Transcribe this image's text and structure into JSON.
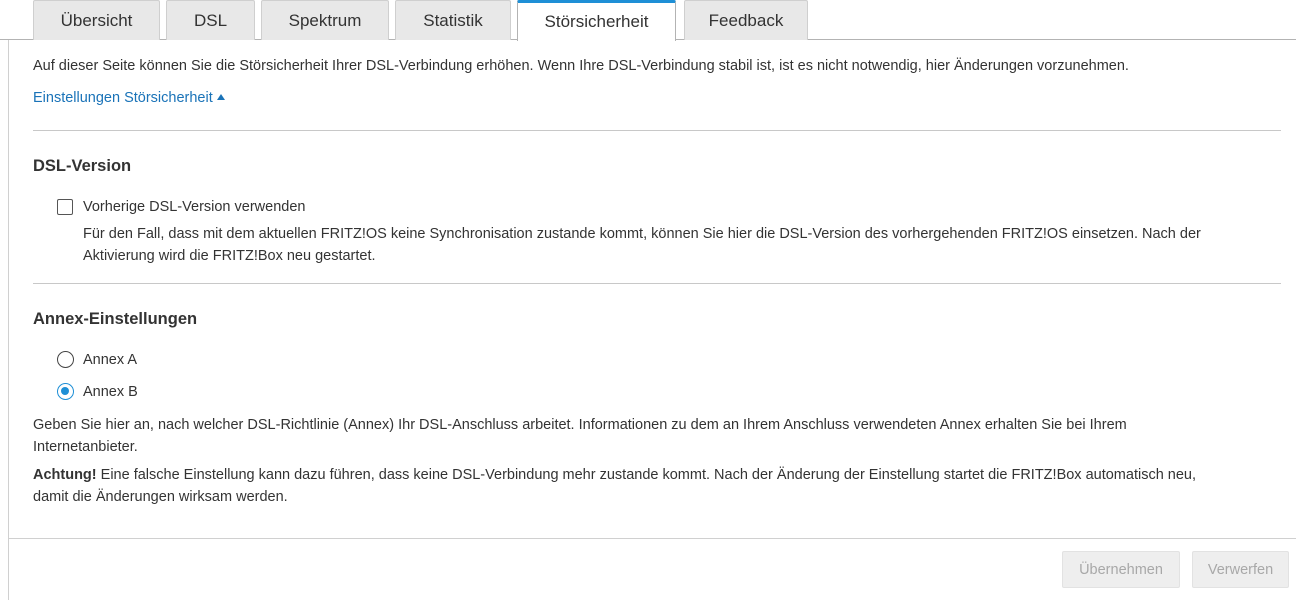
{
  "tabs": [
    {
      "label": "Übersicht",
      "active": false
    },
    {
      "label": "DSL",
      "active": false
    },
    {
      "label": "Spektrum",
      "active": false
    },
    {
      "label": "Statistik",
      "active": false
    },
    {
      "label": "Störsicherheit",
      "active": true
    },
    {
      "label": "Feedback",
      "active": false
    }
  ],
  "intro": "Auf dieser Seite können Sie die Störsicherheit Ihrer DSL-Verbindung erhöhen. Wenn Ihre DSL-Verbindung stabil ist, ist es nicht notwendig, hier Änderungen vorzunehmen.",
  "settings_link": "Einstellungen Störsicherheit",
  "dsl_version": {
    "heading": "DSL-Version",
    "checkbox_label": "Vorherige DSL-Version verwenden",
    "checked": false,
    "description_line1": "Für den Fall, dass mit dem aktuellen FRITZ!OS keine Synchronisation zustande kommt, können Sie hier die DSL-Version des vorhergehenden FRITZ!OS einsetzen. Nach der",
    "description_line2": "Aktivierung wird die FRITZ!Box neu gestartet."
  },
  "annex": {
    "heading": "Annex-Einstellungen",
    "options": [
      {
        "label": "Annex A",
        "selected": false
      },
      {
        "label": "Annex B",
        "selected": true
      }
    ],
    "info_line1": "Geben Sie hier an, nach welcher DSL-Richtlinie (Annex) Ihr DSL-Anschluss arbeitet. Informationen zu dem an Ihrem Anschluss verwendeten Annex erhalten Sie bei Ihrem",
    "info_line2": "Internetanbieter.",
    "warning_bold": "Achtung!",
    "warning_line1": " Eine falsche Einstellung kann dazu führen, dass keine DSL-Verbindung mehr zustande kommt. Nach der Änderung der Einstellung startet die FRITZ!Box automatisch neu,",
    "warning_line2": "damit die Änderungen wirksam werden."
  },
  "buttons": {
    "apply": "Übernehmen",
    "discard": "Verwerfen"
  },
  "colors": {
    "accent": "#1e8fd6",
    "link": "#1a73b8",
    "disabled_text": "#a8a8a8"
  }
}
